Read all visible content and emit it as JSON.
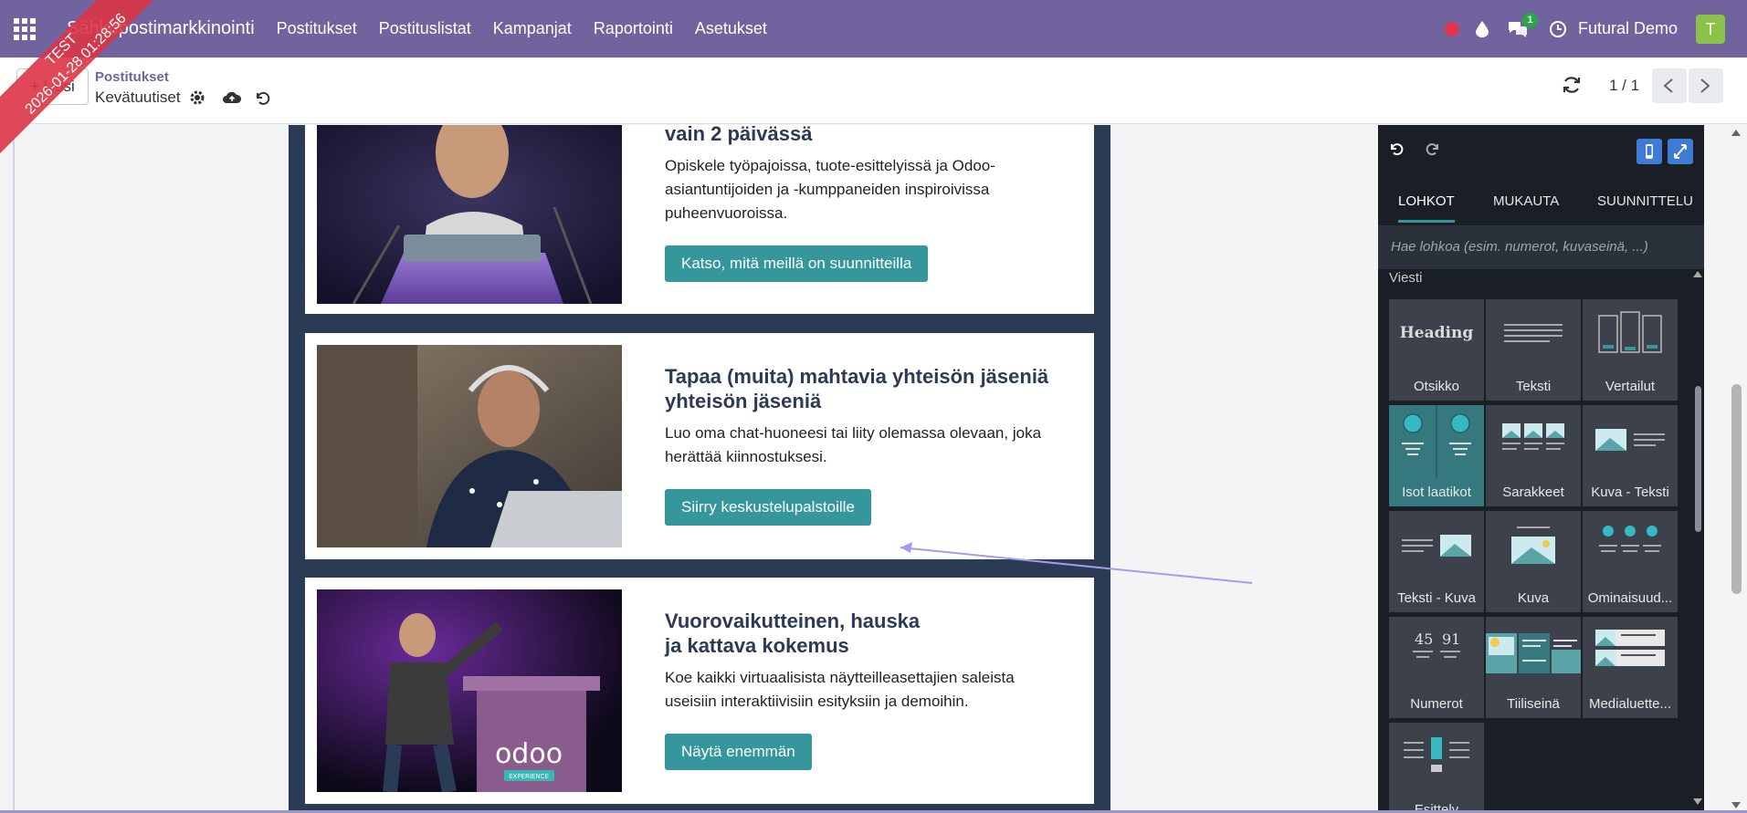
{
  "navbar": {
    "brand": "Sähköpostimarkkinointi",
    "menu": [
      "Postitukset",
      "Postituslistat",
      "Kampanjat",
      "Raportointi",
      "Asetukset"
    ],
    "chat_badge": "1",
    "user_name": "Futural Demo",
    "avatar_letter": "T"
  },
  "ribbon": {
    "line1": "TEST",
    "line2": "2026-01-28 01:28:56"
  },
  "controlbar": {
    "new_label": "+ Uusi",
    "crumb_parent": "Postitukset",
    "crumb_current": "Kevätuutiset",
    "pager": "1 / 1"
  },
  "mail": {
    "card1": {
      "heading": "vain 2 päivässä",
      "body": "Opiskele työpajoissa, tuote-esittelyissä ja Odoo-asiantuntijoiden ja -kumppaneiden inspiroivissa puheenvuoroissa.",
      "cta": "Katso, mitä meillä on suunnitteilla"
    },
    "card2": {
      "heading": "Tapaa (muita) mahtavia yhteisön jäseniä yhteisön jäseniä",
      "body": "Luo oma chat-huoneesi tai liity olemassa olevaan, joka herättää kiinnostuksesi.",
      "cta": "Siirry keskustelupalstoille"
    },
    "card3": {
      "heading_line1": "Vuorovaikutteinen, hauska",
      "heading_line2": "ja kattava kokemus",
      "body": "Koe kaikki virtuaalisista näytteilleasettajien saleista useisiin interaktiivisiin esityksiin ja demoihin.",
      "cta": "Näytä enemmän",
      "logo_text": "odoo",
      "logo_sub": "EXPERIENCE"
    }
  },
  "panel": {
    "tabs": [
      "LOHKOT",
      "MUKAUTA",
      "SUUNNITTELU"
    ],
    "search_placeholder": "Hae lohkoa (esim. numerot, kuvaseinä, ...)",
    "section": "Viesti",
    "heading_thumb": "Heading",
    "numbers_thumb": [
      "45",
      "91"
    ],
    "blocks": [
      "Otsikko",
      "Teksti",
      "Vertailut",
      "Isot laatikot",
      "Sarakkeet",
      "Kuva - Teksti",
      "Teksti - Kuva",
      "Kuva",
      "Ominaisuud...",
      "Numerot",
      "Tiiliseinä",
      "Medialuette...",
      "Esittely"
    ]
  },
  "colors": {
    "navbar": "#71639e",
    "cta": "#35979c",
    "mail_bg": "#2b3a55",
    "panel_bg": "#1a1e25",
    "block_bg": "#3c414b"
  }
}
